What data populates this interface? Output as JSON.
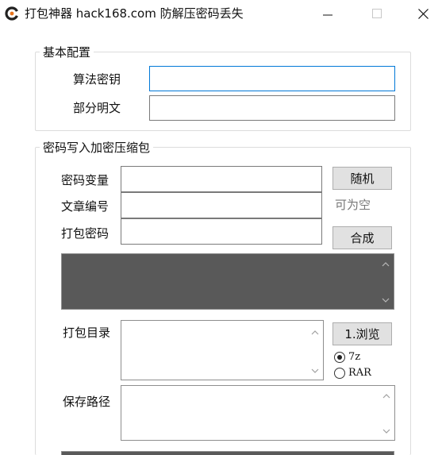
{
  "window": {
    "title": "打包神器 hack168.com 防解压密码丢失",
    "icon": "app-logo-icon",
    "controls": [
      "minimize-icon",
      "maximize-icon",
      "close-icon"
    ]
  },
  "basic_config": {
    "legend": "基本配置",
    "algorithm_key_label": "算法密钥",
    "algorithm_key_value": "",
    "partial_plaintext_label": "部分明文",
    "partial_plaintext_value": ""
  },
  "password_group": {
    "legend": "密码写入加密压缩包",
    "password_var_label": "密码变量",
    "password_var_value": "",
    "random_button": "随机",
    "article_no_label": "文章编号",
    "article_no_value": "",
    "optional_hint": "可为空",
    "pack_password_label": "打包密码",
    "pack_password_value": "",
    "compose_button": "合成",
    "pack_dir_label": "打包目录",
    "browse_button": "1.浏览",
    "format_options": [
      {
        "label": "7z",
        "selected": true
      },
      {
        "label": "RAR",
        "selected": false
      }
    ],
    "save_path_label": "保存路径"
  },
  "colors": {
    "focus_border": "#0078d7",
    "output_area": "#595959",
    "button_face": "#e1e1e1"
  }
}
